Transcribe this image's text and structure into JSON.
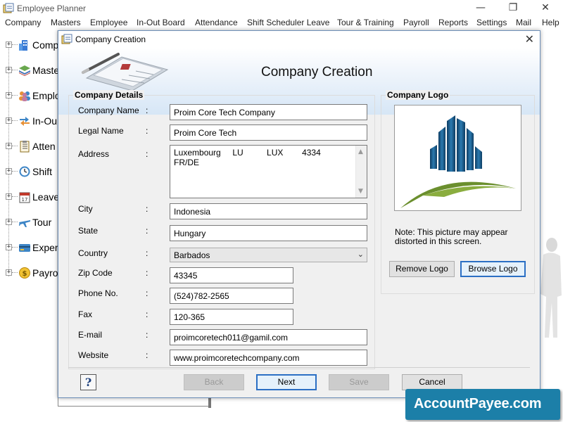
{
  "app": {
    "title": "Employee Planner",
    "controls": {
      "minimize": "—",
      "restore": "❐",
      "close": "✕"
    }
  },
  "menu": [
    "Company",
    "Masters",
    "Employee",
    "In-Out Board",
    "Attendance",
    "Shift Scheduler Leave",
    "Tour & Training",
    "Payroll",
    "Reports",
    "Settings",
    "Mail",
    "Help"
  ],
  "sidebar": {
    "expander": "+",
    "items": [
      {
        "label": "Comp",
        "icon": "building-icon"
      },
      {
        "label": "Maste",
        "icon": "layers-icon"
      },
      {
        "label": "Emplo",
        "icon": "people-icon"
      },
      {
        "label": "In-Ou",
        "icon": "arrows-icon"
      },
      {
        "label": "Atten",
        "icon": "checklist-icon"
      },
      {
        "label": "Shift",
        "icon": "clock-icon"
      },
      {
        "label": "Leave",
        "icon": "calendar-icon"
      },
      {
        "label": "Tour",
        "icon": "airplane-icon"
      },
      {
        "label": "Exper",
        "icon": "card-icon"
      },
      {
        "label": "Payro",
        "icon": "coin-icon"
      }
    ],
    "calendar_day": "17",
    "coin_symbol": "$"
  },
  "dialog": {
    "title": "Company Creation",
    "close": "✕",
    "banner_title": "Company Creation",
    "details": {
      "title": "Company Details",
      "colon": ":",
      "fields": {
        "company_name": {
          "label": "Company Name",
          "value": "Proim Core Tech Company"
        },
        "legal_name": {
          "label": "Legal Name",
          "value": "Proim Core Tech"
        },
        "address": {
          "label": "Address",
          "line1": "Luxembourg     LU          LUX        4334",
          "line2": "FR/DE"
        },
        "city": {
          "label": "City",
          "value": "Indonesia"
        },
        "state": {
          "label": "State",
          "value": "Hungary"
        },
        "country": {
          "label": "Country",
          "value": "Barbados"
        },
        "zip": {
          "label": "Zip Code",
          "value": "43345"
        },
        "phone": {
          "label": "Phone No.",
          "value": "(524)782-2565"
        },
        "fax": {
          "label": "Fax",
          "value": "120-365"
        },
        "email": {
          "label": "E-mail",
          "value": "proimcoretech011@gamil.com"
        },
        "website": {
          "label": "Website",
          "value": "www.proimcoretechcompany.com"
        }
      }
    },
    "logo": {
      "title": "Company Logo",
      "note_line1": "Note: This picture may appear",
      "note_line2": "distorted in this screen.",
      "remove": "Remove Logo",
      "browse": "Browse Logo"
    },
    "footer": {
      "help": "?",
      "back": "Back",
      "next": "Next",
      "save": "Save",
      "cancel": "Cancel"
    }
  },
  "watermark": "AccountPayee.com",
  "colors": {
    "accent": "#2b6fc4",
    "banner": "#d6e6f6",
    "watermark": "#1c7fa8",
    "logo_blue": "#1d5a8a",
    "logo_green": "#6b8f2e"
  }
}
